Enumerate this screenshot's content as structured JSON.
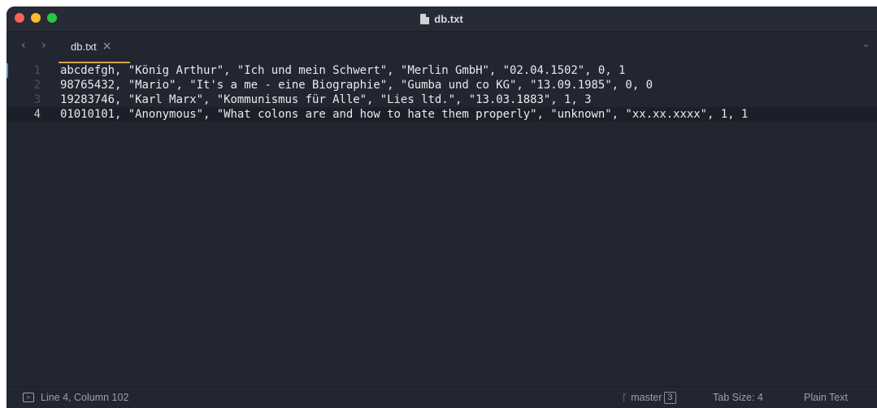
{
  "window": {
    "title": "db.txt"
  },
  "tabs": [
    {
      "label": "db.txt",
      "close": "×"
    }
  ],
  "nav": {
    "back": "‹",
    "forward": "›",
    "dropdown": "⌄"
  },
  "editor": {
    "lines": [
      {
        "number": "1",
        "text": "abcdefgh, \"König Arthur\", \"Ich und mein Schwert\", \"Merlin GmbH\", \"02.04.1502\", 0, 1"
      },
      {
        "number": "2",
        "text": "98765432, \"Mario\", \"It's a me - eine Biographie\", \"Gumba und co KG\", \"13.09.1985\", 0, 0"
      },
      {
        "number": "3",
        "text": "19283746, \"Karl Marx\", \"Kommunismus für Alle\", \"Lies ltd.\", \"13.03.1883\", 1, 3"
      },
      {
        "number": "4",
        "text": "01010101, \"Anonymous\", \"What colons are and how to hate them properly\", \"unknown\", \"xx.xx.xxxx\", 1, 1"
      }
    ]
  },
  "status": {
    "position": "Line 4, Column 102",
    "branch": "master",
    "branch_count": "3",
    "tab_size": "Tab Size: 4",
    "syntax": "Plain Text"
  },
  "colors": {
    "background": "#222631",
    "accent": "#d6a34c",
    "close_button": "#fe5f57",
    "minimize_button": "#febc2e",
    "maximize_button": "#28c840"
  }
}
